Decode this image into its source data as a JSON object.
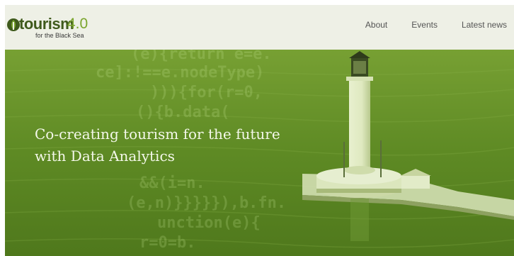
{
  "header": {
    "logo": {
      "word": "tourism",
      "version": "4.0",
      "tagline": "for the Black Sea"
    },
    "nav": [
      "About",
      "Events",
      "Latest news"
    ]
  },
  "hero": {
    "headline_line1": "Co-creating tourism for the future",
    "headline_line2": "with Data Analytics",
    "code_fragments": [
      "(e){return e=e.",
      "ce]:!==e.nodeType)",
      "))){for(r=0,",
      "(){b.data(",
      "&&(i=n.",
      "(e,n)}}}}}),b.fn.",
      "unction(e){",
      "r=0=b."
    ]
  },
  "colors": {
    "header_bg": "#eef0e6",
    "logo_dark": "#3f5a1c",
    "logo_accent": "#7aa52d",
    "hero_green": "#5f8c24",
    "headline_text": "#f4f8ea"
  }
}
